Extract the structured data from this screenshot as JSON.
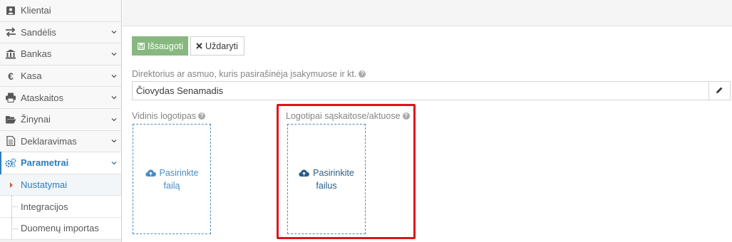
{
  "sidebar": {
    "items": [
      {
        "icon": "user-card-icon",
        "label": "Klientai",
        "chevron": false
      },
      {
        "icon": "exchange-icon",
        "label": "Sandėlis",
        "chevron": true
      },
      {
        "icon": "bank-icon",
        "label": "Bankas",
        "chevron": true
      },
      {
        "icon": "euro-icon",
        "label": "Kasa",
        "chevron": true
      },
      {
        "icon": "print-icon",
        "label": "Ataskaitos",
        "chevron": true
      },
      {
        "icon": "folder-open-icon",
        "label": "Žinynai",
        "chevron": true
      },
      {
        "icon": "file-icon",
        "label": "Deklaravimas",
        "chevron": true
      },
      {
        "icon": "cogs-icon",
        "label": "Parametrai",
        "chevron": true,
        "active": true
      }
    ],
    "subitems": [
      {
        "label": "Nustatymai",
        "current": true
      },
      {
        "label": "Integracijos",
        "current": false
      },
      {
        "label": "Duomenų importas",
        "current": false
      }
    ]
  },
  "toolbar": {
    "save_label": "Išsaugoti",
    "close_label": "Uždaryti"
  },
  "form": {
    "director_label": "Direktorius ar asmuo, kuris pasirašinėja įsakymuose ir kt.",
    "director_value": "Čiovydas Senamadis",
    "internal_logo_label": "Vidinis logotipas",
    "internal_logo_line1": "Pasirinkte",
    "internal_logo_line2": "failą",
    "invoice_logo_label": "Logotipai sąskaitose/aktuose",
    "invoice_logo_line1": "Pasirinkite",
    "invoice_logo_line2": "failus"
  },
  "colors": {
    "accent": "#2b7dbc",
    "save_button": "#87b87f",
    "highlight": "#e0121c",
    "dropzone_border": "#4a8bc2"
  }
}
